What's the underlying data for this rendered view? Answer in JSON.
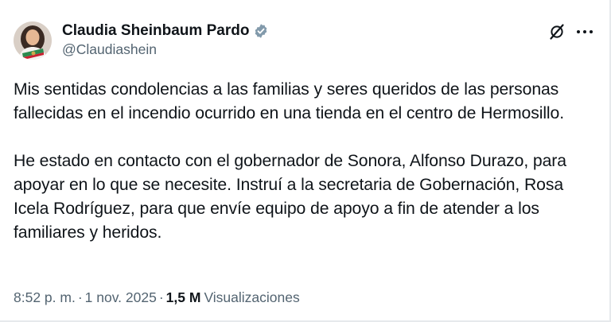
{
  "author": {
    "display_name": "Claudia Sheinbaum Pardo",
    "handle": "@Claudiashein",
    "verified": true,
    "verified_color": "#829aab"
  },
  "tweet": {
    "paragraphs": [
      "Mis sentidas condolencias a las familias y seres queridos de las personas fallecidas en el incendio ocurrido en una tienda en el centro de Hermosillo.",
      "He estado en contacto con el gobernador de Sonora, Alfonso Durazo, para apoyar en lo que se necesite. Instruí a la secretaria de Gobernación, Rosa Icela Rodríguez, para que envíe equipo de apoyo a fin de atender a los familiares y heridos."
    ],
    "time": "8:52 p. m.",
    "separator": "·",
    "date": "1 nov. 2025",
    "views_count": "1,5 M",
    "views_label": "Visualizaciones"
  },
  "icons": {
    "grok": "grok-icon",
    "more": "more-icon",
    "verified": "verified-badge-icon"
  }
}
